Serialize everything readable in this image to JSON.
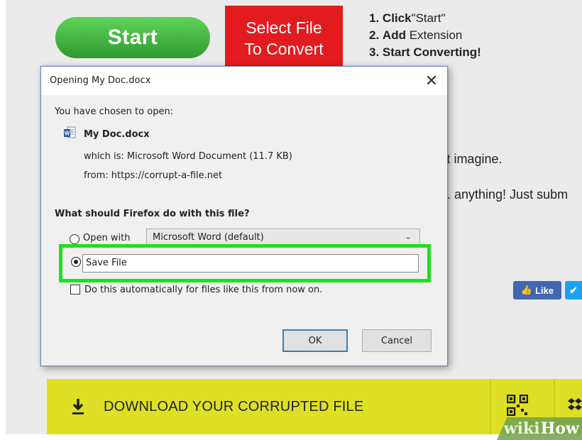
{
  "background": {
    "start_label": "Start",
    "select_file_line1": "Select File",
    "select_file_line2": "To Convert",
    "steps": [
      {
        "num": "1.",
        "bold": "Click",
        "rest": "\"Start\""
      },
      {
        "num": "2.",
        "bold": "Add",
        "rest": "Extension"
      },
      {
        "num": "3.",
        "bold": "Start Converting!",
        "rest": ""
      }
    ],
    "partial_text1": "'t imagine.",
    "partial_text2": ". anything! Just subm",
    "like_label": "Like",
    "download_label": "DOWNLOAD YOUR CORRUPTED FILE",
    "watermark_wiki": "wiki",
    "watermark_how": "How",
    "colors": {
      "start_green": "#3fb83b",
      "select_red": "#e21b1f",
      "download_yellow": "#dfe026",
      "facebook": "#4267b2",
      "twitter": "#1da1f2",
      "highlight_green": "#1ee01e"
    }
  },
  "dialog": {
    "title": "Opening My Doc.docx",
    "close_glyph": "✕",
    "chosen_text": "You have chosen to open:",
    "file_name": "My Doc.docx",
    "which_is": "which is:  Microsoft Word Document (11.7 KB)",
    "from": "from:  https://corrupt-a-file.net",
    "question": "What should Firefox do with this file?",
    "open_with_label": "Open with",
    "app_selected": "Microsoft Word (default)",
    "save_file_label": "Save File",
    "auto_label": "Do this automatically for files like this from now on.",
    "ok_label": "OK",
    "cancel_label": "Cancel",
    "selected_option": "save_file",
    "auto_checked": false
  }
}
